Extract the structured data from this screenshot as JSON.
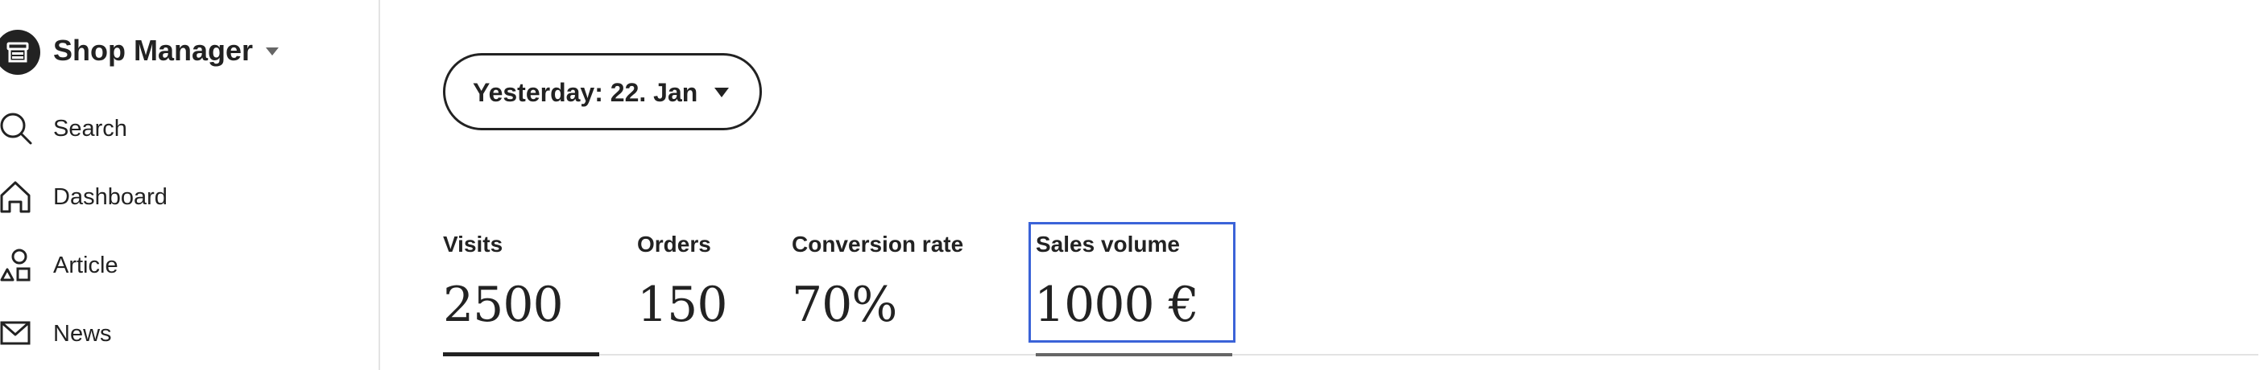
{
  "sidebar": {
    "brand": {
      "title": "Shop Manager",
      "logo_icon": "shop-storefront-icon",
      "caret_icon": "caret-down-icon"
    },
    "items": [
      {
        "label": "Search",
        "icon": "search-icon"
      },
      {
        "label": "Dashboard",
        "icon": "home-icon"
      },
      {
        "label": "Article",
        "icon": "shapes-icon"
      },
      {
        "label": "News",
        "icon": "envelope-icon"
      }
    ]
  },
  "main": {
    "date_filter": {
      "label": "Yesterday: 22. Jan",
      "caret_icon": "caret-down-icon"
    },
    "stats": [
      {
        "label": "Visits",
        "value": "2500",
        "active": true
      },
      {
        "label": "Orders",
        "value": "150",
        "active": false
      },
      {
        "label": "Conversion rate",
        "value": "70%",
        "active": false
      },
      {
        "label": "Sales volume",
        "value": "1000 €",
        "active": false,
        "highlighted": true
      }
    ]
  },
  "colors": {
    "text": "#222222",
    "divider": "#e3e3e3",
    "highlight": "#3b63d8",
    "underline_muted": "#666666"
  }
}
